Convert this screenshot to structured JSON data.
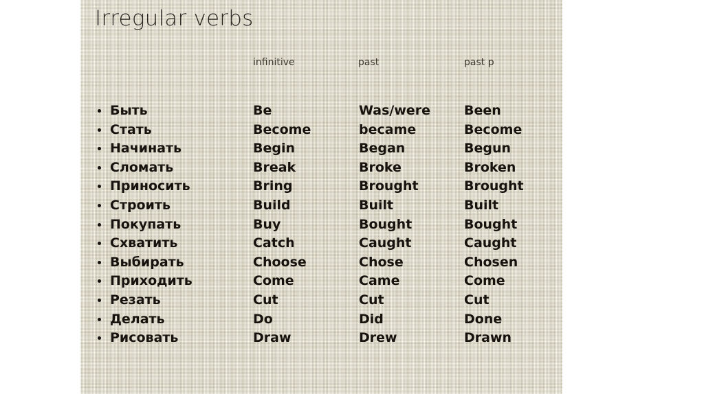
{
  "slide": {
    "title": "Irregular verbs",
    "background_color": "#ddd8c3",
    "text_color": "#17120e",
    "title_color": "#2a2521"
  },
  "headers": {
    "russian": "",
    "infinitive": "infinitive",
    "past": "past",
    "past_participle": "past p"
  },
  "rows": [
    {
      "ru": "Быть",
      "inf": "Be",
      "past": "Was/were",
      "pp": "Been"
    },
    {
      "ru": "Стать",
      "inf": "Become",
      "past": "became",
      "pp": "Become"
    },
    {
      "ru": "Начинать",
      "inf": "Begin",
      "past": "Began",
      "pp": "Begun"
    },
    {
      "ru": "Сломать",
      "inf": "Break",
      "past": "Broke",
      "pp": "Broken"
    },
    {
      "ru": "Приносить",
      "inf": "Bring",
      "past": "Brought",
      "pp": "Brought"
    },
    {
      "ru": "Строить",
      "inf": "Build",
      "past": "Built",
      "pp": "Built"
    },
    {
      "ru": "Покупать",
      "inf": "Buy",
      "past": "Bought",
      "pp": "Bought"
    },
    {
      "ru": "Схватить",
      "inf": "Catch",
      "past": "Caught",
      "pp": "Caught"
    },
    {
      "ru": "Выбирать",
      "inf": "Choose",
      "past": "Chose",
      "pp": "Chosen"
    },
    {
      "ru": "Приходить",
      "inf": "Come",
      "past": "Came",
      "pp": "Come"
    },
    {
      "ru": "Резать",
      "inf": "Cut",
      "past": "Cut",
      "pp": "Cut"
    },
    {
      "ru": "Делать",
      "inf": "Do",
      "past": "Did",
      "pp": "Done"
    },
    {
      "ru": "Рисовать",
      "inf": "Draw",
      "past": "Drew",
      "pp": "Drawn"
    }
  ]
}
